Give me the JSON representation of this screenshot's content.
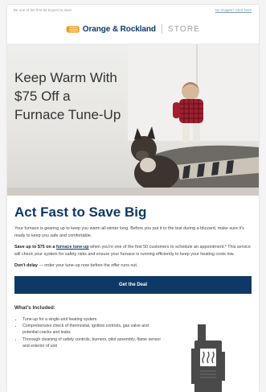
{
  "preheader": {
    "left": "Be one of the first 50 buyers to save.",
    "right": "No images? Click here"
  },
  "logo": {
    "brand": "Orange & Rockland",
    "store": "STORE"
  },
  "hero": {
    "title": "Keep Warm With $75 Off a Furnace Tune-Up"
  },
  "content": {
    "headline": "Act Fast to Save Big",
    "intro": "Your furnace is gearing up to keep you warm all winter long. Before you put it to the test during a blizzard, make sure it's ready to keep you safe and comfortable.",
    "offer_bold": "Save up to $75 on a",
    "offer_link": "furnace tune-up",
    "offer_rest": "when you're one of the first 50 customers to schedule an appointment.* This service will check your system for safety risks and ensure your furnace is running efficiently to keep your heating costs low.",
    "delay_bold": "Don't delay",
    "delay_rest": " — order your tune-up now before the offer runs out.",
    "cta": "Get the Deal",
    "included_title": "What's Included:",
    "included": [
      "Tune-up for a single-unit heating system",
      "Comprehensive check of thermostat, ignition controls, gas valve and potential cracks and leaks",
      "Thorough cleaning of safety controls, burners, pilot assembly, flame sensor and exterior of unit"
    ]
  },
  "colors": {
    "navy": "#0e3966",
    "orange": "#f39a1e"
  }
}
